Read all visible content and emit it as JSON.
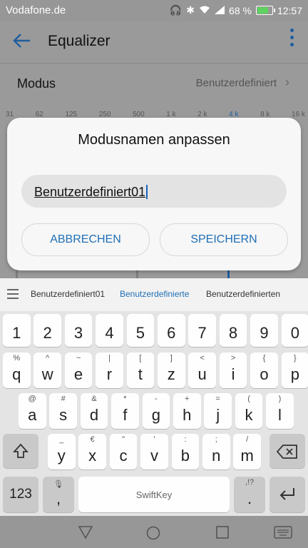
{
  "status": {
    "carrier": "Vodafone.de",
    "battery": "68 %",
    "time": "12:57",
    "battery_level": 0.68
  },
  "appbar": {
    "title": "Equalizer"
  },
  "modus": {
    "label": "Modus",
    "value": "Benutzerdefiniert"
  },
  "frequencies": [
    "31",
    "62",
    "125",
    "250",
    "500",
    "1 k",
    "2 k",
    "4 k",
    "8 k",
    "16 k"
  ],
  "dialog": {
    "title": "Modusnamen anpassen",
    "input_value": "Benutzerdefiniert01",
    "cancel": "ABBRECHEN",
    "save": "SPEICHERN"
  },
  "suggestions": [
    "Benutzerdefiniert01",
    "Benutzerdefinierte",
    "Benutzerdefinierten"
  ],
  "keyboard": {
    "row_numbers": [
      "1",
      "2",
      "3",
      "4",
      "5",
      "6",
      "7",
      "8",
      "9",
      "0"
    ],
    "row1": [
      {
        "k": "q",
        "a": "%"
      },
      {
        "k": "w",
        "a": "^"
      },
      {
        "k": "e",
        "a": "~"
      },
      {
        "k": "r",
        "a": "|"
      },
      {
        "k": "t",
        "a": "["
      },
      {
        "k": "z",
        "a": "]"
      },
      {
        "k": "u",
        "a": "<"
      },
      {
        "k": "i",
        "a": ">"
      },
      {
        "k": "o",
        "a": "{"
      },
      {
        "k": "p",
        "a": "}"
      }
    ],
    "row2": [
      {
        "k": "a",
        "a": "@"
      },
      {
        "k": "s",
        "a": "#"
      },
      {
        "k": "d",
        "a": "&"
      },
      {
        "k": "f",
        "a": "*"
      },
      {
        "k": "g",
        "a": "-"
      },
      {
        "k": "h",
        "a": "+"
      },
      {
        "k": "j",
        "a": "="
      },
      {
        "k": "k",
        "a": "("
      },
      {
        "k": "l",
        "a": ")"
      }
    ],
    "row3": [
      {
        "k": "y",
        "a": "_"
      },
      {
        "k": "x",
        "a": "€"
      },
      {
        "k": "c",
        "a": "\""
      },
      {
        "k": "v",
        "a": "'"
      },
      {
        "k": "b",
        "a": ":"
      },
      {
        "k": "n",
        "a": ";"
      },
      {
        "k": "m",
        "a": "/"
      }
    ],
    "numbers_key": "123",
    "comma_key": ",",
    "period_key": ".",
    "period_alt": ",!?",
    "space_label": "SwiftKey"
  }
}
